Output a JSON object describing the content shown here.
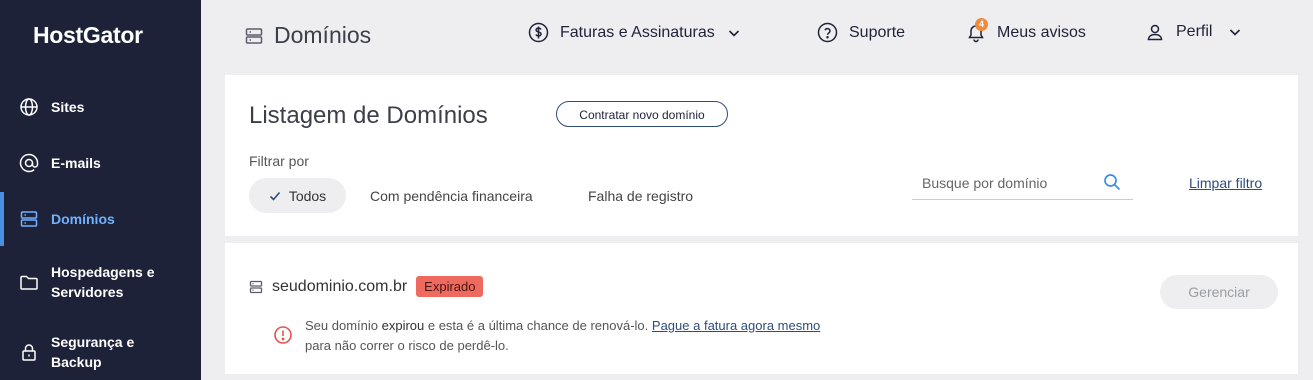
{
  "app": {
    "logo": "HostGator"
  },
  "sidebar": {
    "items": [
      {
        "label": "Sites",
        "icon": "globe-icon"
      },
      {
        "label": "E-mails",
        "icon": "at-sign-icon"
      },
      {
        "label": "Domínios",
        "icon": "server-icon",
        "active": true
      },
      {
        "label": "Hospedagens e Servidores",
        "icon": "folder-icon"
      },
      {
        "label": "Segurança e Backup",
        "icon": "lock-icon"
      }
    ]
  },
  "header": {
    "title": "Domínios",
    "title_icon": "server-icon",
    "invoices": "Faturas e Assinaturas",
    "support": "Suporte",
    "notifications": "Meus avisos",
    "notifications_count": "4",
    "profile": "Perfil"
  },
  "listing": {
    "title": "Listagem de Domínios",
    "new_domain_button": "Contratar novo domínio",
    "filter_label": "Filtrar por",
    "filters": [
      "Todos",
      "Com pendência financeira",
      "Falha de registro"
    ],
    "search_placeholder": "Busque por domínio",
    "clear_filter": "Limpar filtro"
  },
  "domain": {
    "name": "seudominio.com.br",
    "status": "Expirado",
    "manage_button": "Gerenciar",
    "warning_part1": "Seu domínio ",
    "warning_bold": "expirou",
    "warning_part2": " e esta é a última chance de renová-lo.",
    "warning_link": "Pague a fatura agora mesmo",
    "warning_line2": "para não correr o risco de perdê-lo."
  },
  "colors": {
    "sidebar_bg": "#1e2238",
    "active_nav": "#6fb2ff",
    "expired_badge": "#ee6a5f",
    "notification_badge": "#f08a3c",
    "link": "#2e4d7a"
  }
}
